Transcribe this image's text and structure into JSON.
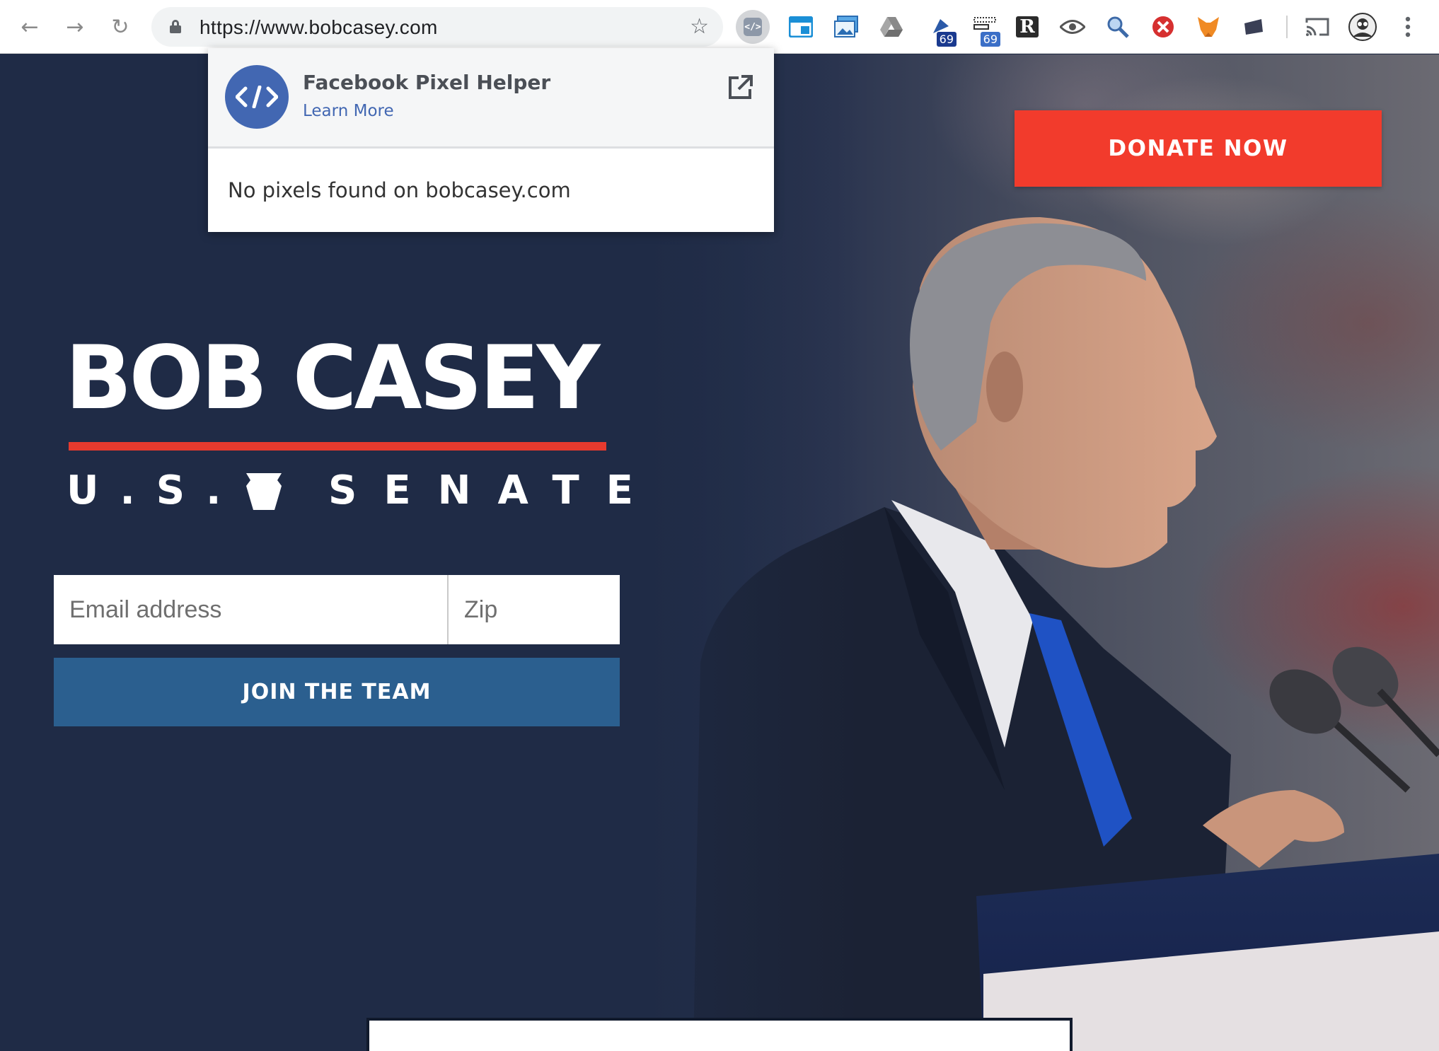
{
  "browser": {
    "url": "https://www.bobcasey.com",
    "nav": {
      "back_icon": "←",
      "forward_icon": "→",
      "reload_icon": "↻"
    },
    "extensions": [
      {
        "name": "facebook-pixel-helper",
        "label": "</>"
      },
      {
        "name": "window-extension"
      },
      {
        "name": "image-extension"
      },
      {
        "name": "google-drive"
      },
      {
        "name": "extension-badge-1",
        "badge": "69"
      },
      {
        "name": "extension-badge-2",
        "badge": "69"
      },
      {
        "name": "readability",
        "label": "R"
      },
      {
        "name": "eye-extension"
      },
      {
        "name": "search-extension"
      },
      {
        "name": "blocker-extension"
      },
      {
        "name": "metamask"
      },
      {
        "name": "generic-extension"
      },
      {
        "name": "cast"
      },
      {
        "name": "profile-avatar"
      },
      {
        "name": "menu"
      }
    ]
  },
  "popup": {
    "title": "Facebook Pixel Helper",
    "link": "Learn More",
    "message": "No pixels found on bobcasey.com"
  },
  "page": {
    "donate_label": "DONATE NOW",
    "logo_name": "BOB CASEY",
    "logo_us": "U.S.",
    "logo_senate": "SENATE",
    "email_placeholder": "Email address",
    "zip_placeholder": "Zip",
    "join_label": "JOIN THE TEAM"
  },
  "colors": {
    "navy": "#1f2b46",
    "donate_red": "#f23b2c",
    "rule_red": "#e63a2e",
    "join_blue": "#2b5f8f",
    "facebook_blue": "#4267b2"
  }
}
